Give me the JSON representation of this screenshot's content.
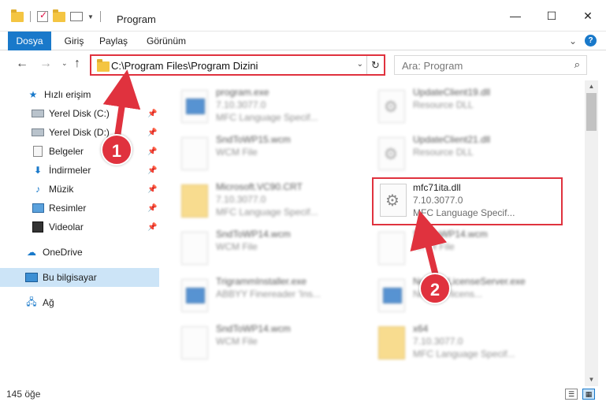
{
  "window": {
    "title": "Program",
    "controls": {
      "minimize": "—",
      "maximize": "☐",
      "close": "✕"
    }
  },
  "ribbon": {
    "tabs": [
      "Dosya",
      "Giriş",
      "Paylaş",
      "Görünüm"
    ],
    "expand_caret": "⌄",
    "help": "?"
  },
  "nav": {
    "back": "←",
    "forward": "→",
    "up": "↑",
    "recent_caret": "⌄",
    "address": "C:\\Program Files\\Program Dizini",
    "address_caret": "⌄",
    "refresh": "↻",
    "search_placeholder": "Ara: Program",
    "search_icon": "⌕"
  },
  "sidebar": {
    "items": [
      {
        "label": "Hızlı erişim",
        "icon": "star-icon",
        "pinned": false
      },
      {
        "label": "Yerel Disk (C:)",
        "icon": "drive-icon",
        "pinned": true
      },
      {
        "label": "Yerel Disk (D:)",
        "icon": "drive-icon",
        "pinned": true
      },
      {
        "label": "Belgeler",
        "icon": "documents-icon",
        "pinned": true
      },
      {
        "label": "İndirmeler",
        "icon": "download-icon",
        "pinned": true
      },
      {
        "label": "Müzik",
        "icon": "music-icon",
        "pinned": true
      },
      {
        "label": "Resimler",
        "icon": "pictures-icon",
        "pinned": true
      },
      {
        "label": "Videolar",
        "icon": "videos-icon",
        "pinned": true
      },
      {
        "label": "OneDrive",
        "icon": "cloud-icon",
        "pinned": false
      },
      {
        "label": "Bu bilgisayar",
        "icon": "computer-icon",
        "pinned": false,
        "selected": true
      },
      {
        "label": "Ağ",
        "icon": "network-icon",
        "pinned": false
      }
    ],
    "pin_glyph": "📌"
  },
  "files": [
    {
      "name": "program.exe",
      "line2": "7.10.3077.0",
      "line3": "MFC Language Specif...",
      "type": "app",
      "blurred": true
    },
    {
      "name": "UpdateClient19.dll",
      "line2": "Resource DLL",
      "line3": "",
      "type": "dll",
      "blurred": true
    },
    {
      "name": "SndToWP15.wcm",
      "line2": "WCM File",
      "line3": "",
      "type": "doc",
      "blurred": true
    },
    {
      "name": "UpdateClient21.dll",
      "line2": "Resource DLL",
      "line3": "",
      "type": "dll",
      "blurred": true
    },
    {
      "name": "Microsoft.VC90.CRT",
      "line2": "7.10.3077.0",
      "line3": "MFC Language Specif...",
      "type": "folder",
      "blurred": true
    },
    {
      "name": "mfc71ita.dll",
      "line2": "7.10.3077.0",
      "line3": "MFC Language Specif...",
      "type": "dll",
      "blurred": false,
      "highlight": true
    },
    {
      "name": "SndToWP14.wcm",
      "line2": "WCM File",
      "line3": "",
      "type": "doc",
      "blurred": true
    },
    {
      "name": "SndToWP14.wcm",
      "line2": "WCM File",
      "line3": "",
      "type": "doc",
      "blurred": true
    },
    {
      "name": "TrigrammInstaller.exe",
      "line2": "ABBYY Finereader 'Ins...",
      "line3": "",
      "type": "app",
      "blurred": true
    },
    {
      "name": "NetworkLicenseServer.exe",
      "line2": "Network licens...",
      "line3": "",
      "type": "app",
      "blurred": true
    },
    {
      "name": "SndToWP14.wcm",
      "line2": "WCM File",
      "line3": "",
      "type": "doc",
      "blurred": true
    },
    {
      "name": "x64",
      "line2": "7.10.3077.0",
      "line3": "MFC Language Specif...",
      "type": "folder",
      "blurred": true
    }
  ],
  "status": {
    "count": "145 öğe"
  },
  "callouts": {
    "one": "1",
    "two": "2"
  },
  "colors": {
    "accent": "#1979ca",
    "highlight_red": "#e0323e",
    "selected_bg": "#cce4f7"
  }
}
